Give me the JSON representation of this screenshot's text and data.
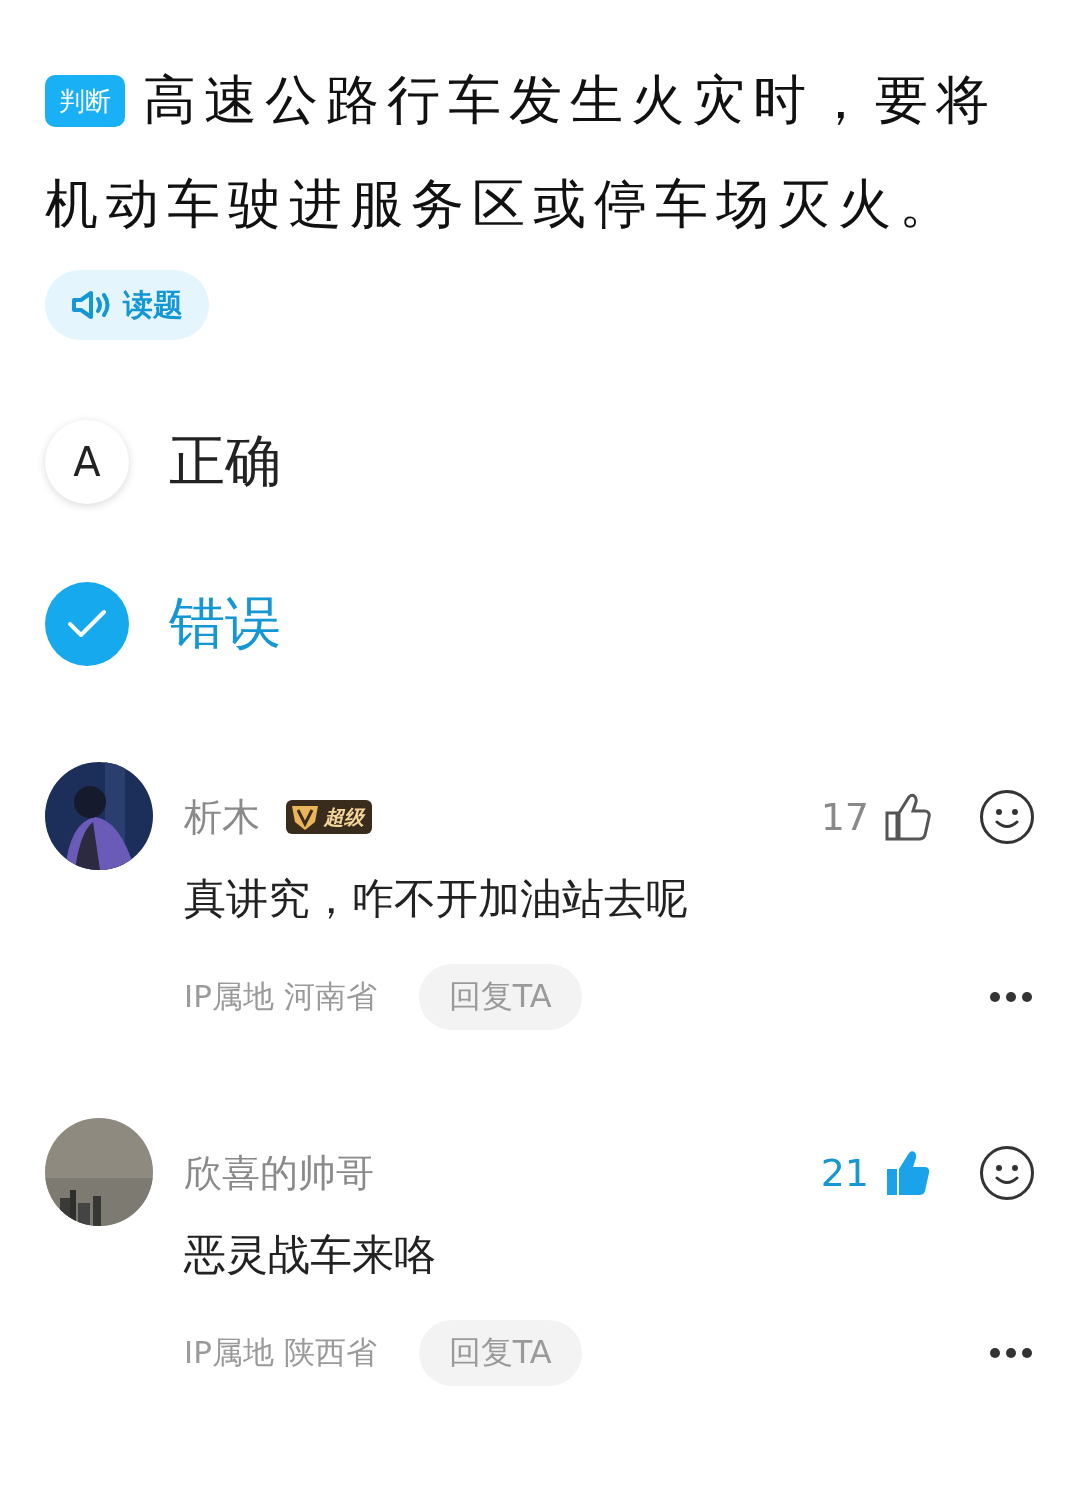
{
  "question": {
    "type_badge": "判断",
    "text": "高速公路行车发生火灾时，要将机动车驶进服务区或停车场灭火。"
  },
  "read_button": "读题",
  "options": [
    {
      "letter": "A",
      "text": "正确",
      "selected": false
    },
    {
      "text": "错误",
      "selected": true
    }
  ],
  "comments": [
    {
      "name": "析木",
      "vip_label": "超级",
      "likes": "17",
      "liked": false,
      "body": "真讲究，咋不开加油站去呢",
      "ip": "IP属地 河南省",
      "reply": "回复TA"
    },
    {
      "name": "欣喜的帅哥",
      "likes": "21",
      "liked": true,
      "body": "恶灵战车来咯",
      "ip": "IP属地 陕西省",
      "reply": "回复TA"
    }
  ]
}
